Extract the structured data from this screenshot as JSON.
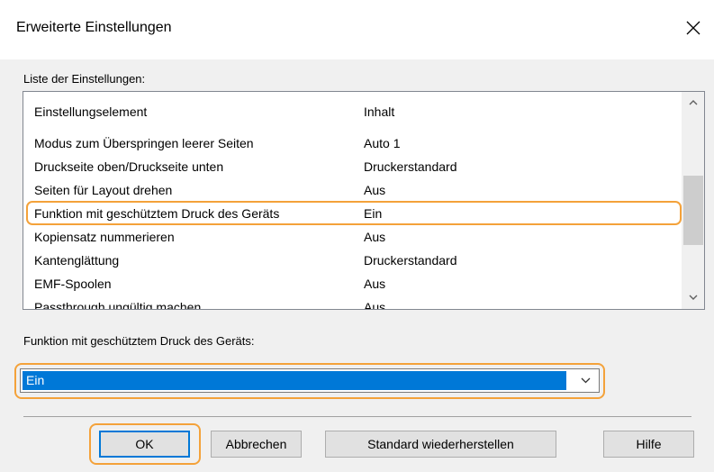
{
  "window": {
    "title": "Erweiterte Einstellungen"
  },
  "icons": {
    "close": "close-icon",
    "scroll_up": "chevron-up-icon",
    "scroll_down": "chevron-down-icon",
    "dropdown": "chevron-down-icon"
  },
  "settings_list": {
    "label": "Liste der Einstellungen:",
    "columns": [
      "Einstellungselement",
      "Inhalt"
    ],
    "rows": [
      {
        "name": "Modus zum Überspringen leerer Seiten",
        "value": "Auto 1"
      },
      {
        "name": "Druckseite oben/Druckseite unten",
        "value": "Druckerstandard"
      },
      {
        "name": "Seiten für Layout drehen",
        "value": "Aus"
      },
      {
        "name": "Funktion mit geschütztem Druck des Geräts",
        "value": "Ein"
      },
      {
        "name": "Kopiensatz nummerieren",
        "value": "Aus"
      },
      {
        "name": "Kantenglättung",
        "value": "Druckerstandard"
      },
      {
        "name": "EMF-Spoolen",
        "value": "Aus"
      },
      {
        "name": "Passthrough ungültig machen",
        "value": "Aus"
      }
    ],
    "selected_index": 3
  },
  "selected_setting": {
    "label": "Funktion mit geschütztem Druck des Geräts:",
    "value": "Ein"
  },
  "buttons": {
    "ok": "OK",
    "cancel": "Abbrechen",
    "restore_defaults": "Standard wiederherstellen",
    "help": "Hilfe"
  },
  "colors": {
    "highlight_ring": "#f4a23a",
    "selection": "#0078d7"
  }
}
